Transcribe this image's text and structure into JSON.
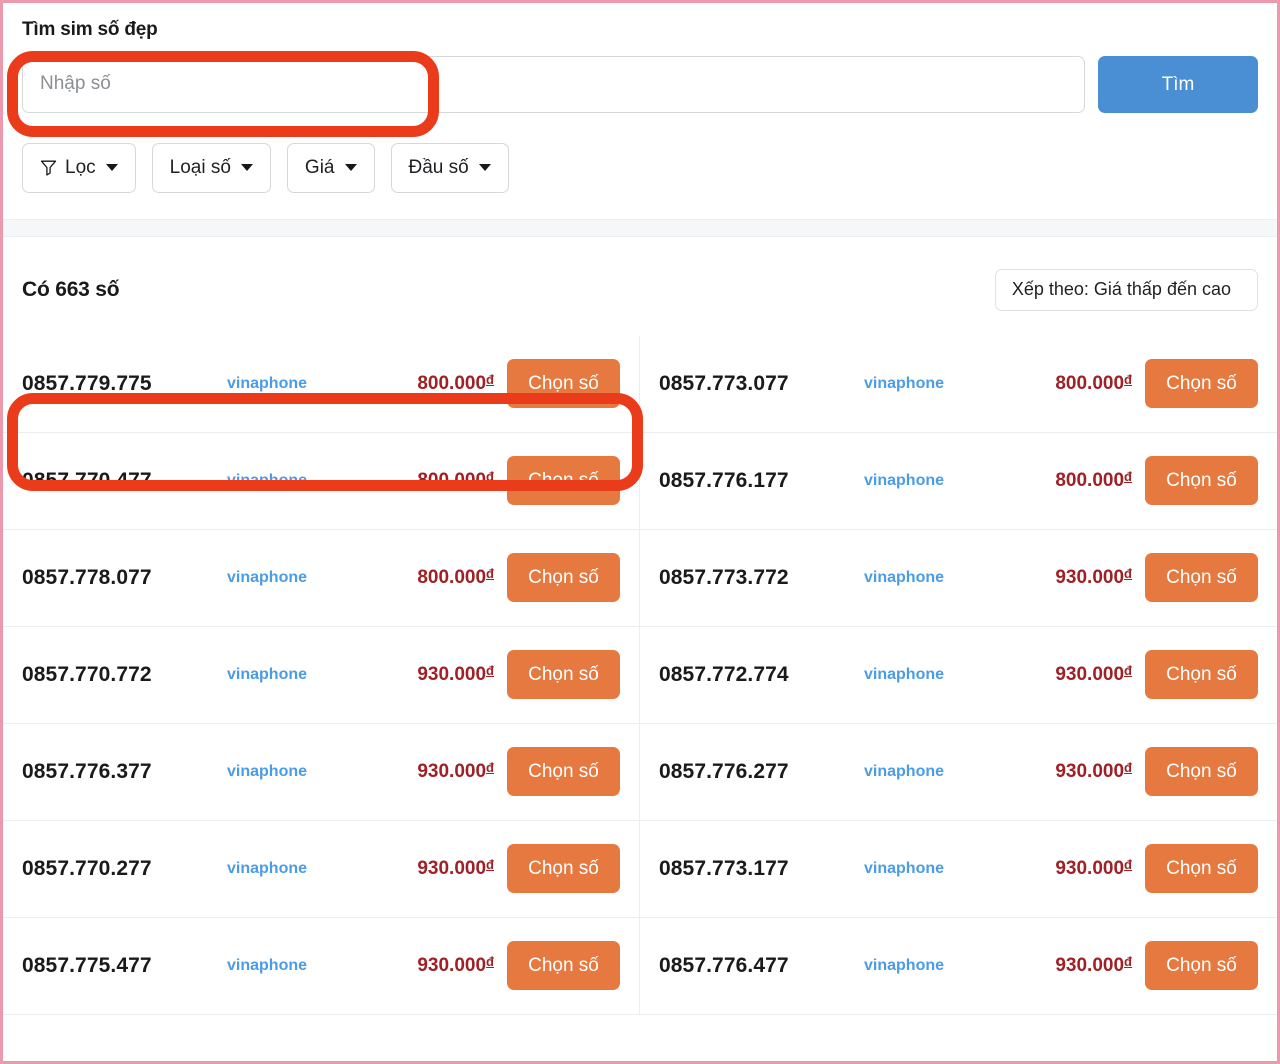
{
  "search": {
    "title": "Tìm sim số đẹp",
    "input_value": "",
    "placeholder": "Nhập số",
    "submit_label": "Tìm",
    "submit_color": "#4a8fd4"
  },
  "filters": [
    {
      "label": "Lọc",
      "icon": "funnel-icon",
      "has_caret": true
    },
    {
      "label": "Loại số",
      "icon": null,
      "has_caret": true
    },
    {
      "label": "Giá",
      "icon": null,
      "has_caret": true
    },
    {
      "label": "Đầu số",
      "icon": null,
      "has_caret": true
    }
  ],
  "results": {
    "count_label": "Có 663 số",
    "count": 663,
    "sort_label": "Xếp theo: Giá thấp đến cao",
    "choose_label": "Chọn số",
    "currency_symbol": "đ",
    "accent_orange": "#e67940",
    "price_color": "#9f2025",
    "carrier_color": "#4b9ce6",
    "left_column": [
      {
        "sim": "0857.779.775",
        "carrier": "vinaphone",
        "price": "800.000",
        "currency": "đ",
        "action": "Chọn số"
      },
      {
        "sim": "0857.770.477",
        "carrier": "vinaphone",
        "price": "800.000",
        "currency": "đ",
        "action": "Chọn số"
      },
      {
        "sim": "0857.778.077",
        "carrier": "vinaphone",
        "price": "800.000",
        "currency": "đ",
        "action": "Chọn số"
      },
      {
        "sim": "0857.770.772",
        "carrier": "vinaphone",
        "price": "930.000",
        "currency": "đ",
        "action": "Chọn số"
      },
      {
        "sim": "0857.776.377",
        "carrier": "vinaphone",
        "price": "930.000",
        "currency": "đ",
        "action": "Chọn số"
      },
      {
        "sim": "0857.770.277",
        "carrier": "vinaphone",
        "price": "930.000",
        "currency": "đ",
        "action": "Chọn số"
      },
      {
        "sim": "0857.775.477",
        "carrier": "vinaphone",
        "price": "930.000",
        "currency": "đ",
        "action": "Chọn số"
      }
    ],
    "right_column": [
      {
        "sim": "0857.773.077",
        "carrier": "vinaphone",
        "price": "800.000",
        "currency": "đ",
        "action": "Chọn số"
      },
      {
        "sim": "0857.776.177",
        "carrier": "vinaphone",
        "price": "800.000",
        "currency": "đ",
        "action": "Chọn số"
      },
      {
        "sim": "0857.773.772",
        "carrier": "vinaphone",
        "price": "930.000",
        "currency": "đ",
        "action": "Chọn số"
      },
      {
        "sim": "0857.772.774",
        "carrier": "vinaphone",
        "price": "930.000",
        "currency": "đ",
        "action": "Chọn số"
      },
      {
        "sim": "0857.776.277",
        "carrier": "vinaphone",
        "price": "930.000",
        "currency": "đ",
        "action": "Chọn số"
      },
      {
        "sim": "0857.773.177",
        "carrier": "vinaphone",
        "price": "930.000",
        "currency": "đ",
        "action": "Chọn số"
      },
      {
        "sim": "0857.776.477",
        "carrier": "vinaphone",
        "price": "930.000",
        "currency": "đ",
        "action": "Chọn số"
      }
    ]
  },
  "annotations": {
    "color": "#ea3b1a",
    "boxes": [
      {
        "target": "search-input"
      },
      {
        "target": "first-result-row"
      }
    ]
  }
}
